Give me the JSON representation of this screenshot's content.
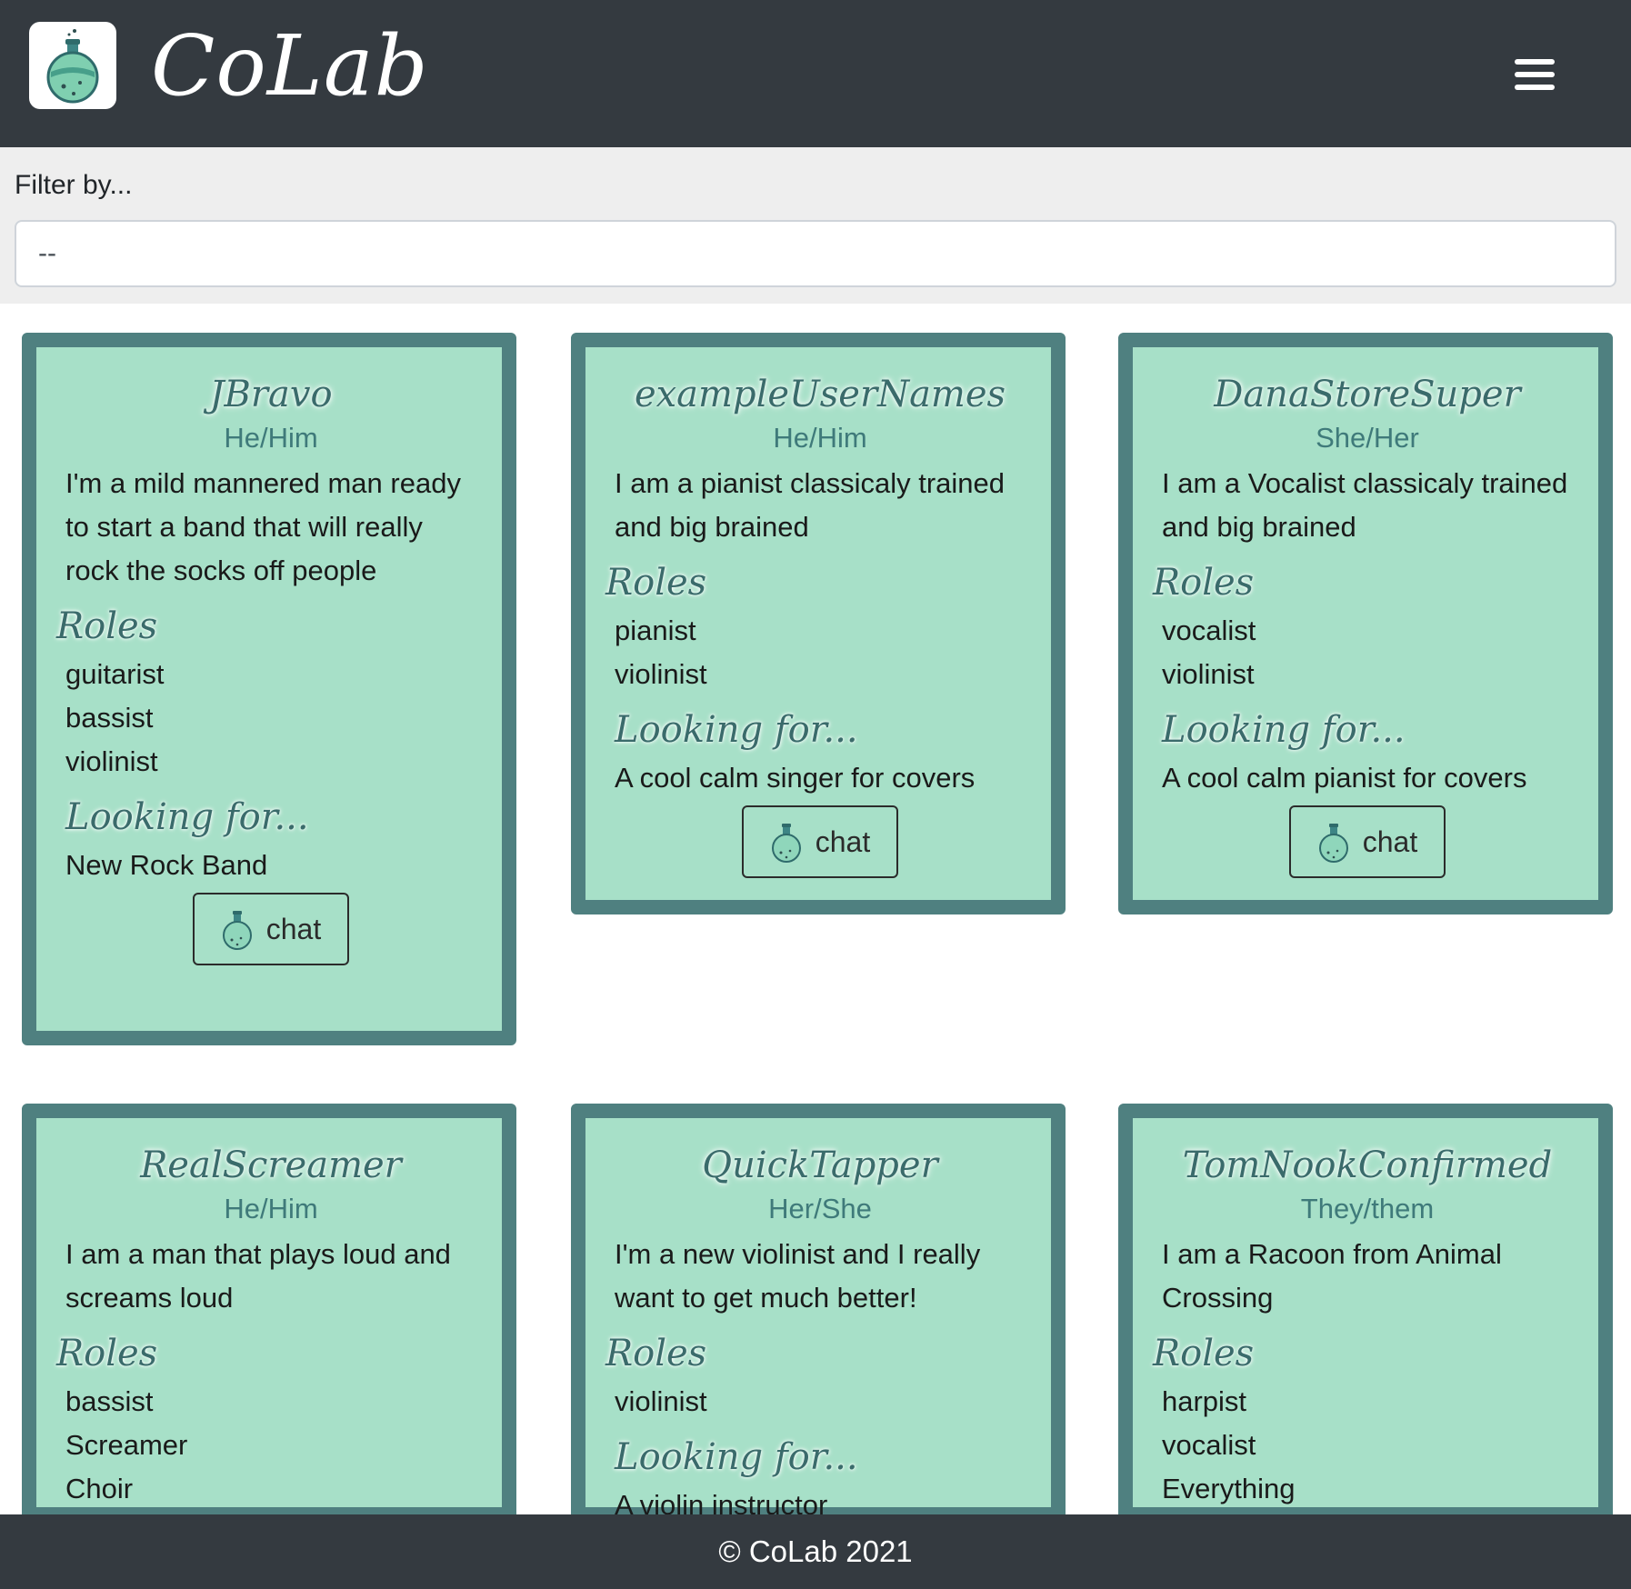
{
  "app": {
    "brand": "CoLab",
    "logo_icon": "flask-icon",
    "menu_icon": "hamburger-menu-icon"
  },
  "filter": {
    "label": "Filter by...",
    "selected": "--"
  },
  "chat_label": "chat",
  "cards": [
    {
      "name": "JBravo",
      "pronouns": "He/Him",
      "bio": "I'm a mild mannered man ready to start a band that will really rock the socks off people",
      "roles_heading": "Roles",
      "roles": [
        "guitarist",
        "bassist",
        "violinist"
      ],
      "looking_heading": "Looking for...",
      "looking_for": "New Rock Band"
    },
    {
      "name": "exampleUserNames",
      "pronouns": "He/Him",
      "bio": "I am a pianist classicaly trained and big brained",
      "roles_heading": "Roles",
      "roles": [
        "pianist",
        "violinist"
      ],
      "looking_heading": "Looking for...",
      "looking_for": "A cool calm singer for covers"
    },
    {
      "name": "DanaStoreSuper",
      "pronouns": "She/Her",
      "bio": "I am a Vocalist classicaly trained and big brained",
      "roles_heading": "Roles",
      "roles": [
        "vocalist",
        "violinist"
      ],
      "looking_heading": "Looking for...",
      "looking_for": "A cool calm pianist for covers"
    },
    {
      "name": "RealScreamer",
      "pronouns": "He/Him",
      "bio": "I am a man that plays loud and screams loud",
      "roles_heading": "Roles",
      "roles": [
        "bassist",
        "Screamer",
        "Choir"
      ]
    },
    {
      "name": "QuickTapper",
      "pronouns": "Her/She",
      "bio": "I'm a new violinist and I really want to get much better!",
      "roles_heading": "Roles",
      "roles": [
        "violinist"
      ],
      "looking_heading": "Looking for...",
      "looking_for": "A violin instructor"
    },
    {
      "name": "TomNookConfirmed",
      "pronouns": "They/them",
      "bio": "I am a Racoon from Animal Crossing",
      "roles_heading": "Roles",
      "roles": [
        "harpist",
        "vocalist",
        "Everything"
      ]
    }
  ],
  "footer": {
    "copyright": "© CoLab 2021"
  },
  "colors": {
    "navbar": "#343a40",
    "card_background": "#a7e0c8",
    "card_border": "#4f8080",
    "heading_teal": "#3a6b6b",
    "filter_background": "#eeeeee"
  }
}
